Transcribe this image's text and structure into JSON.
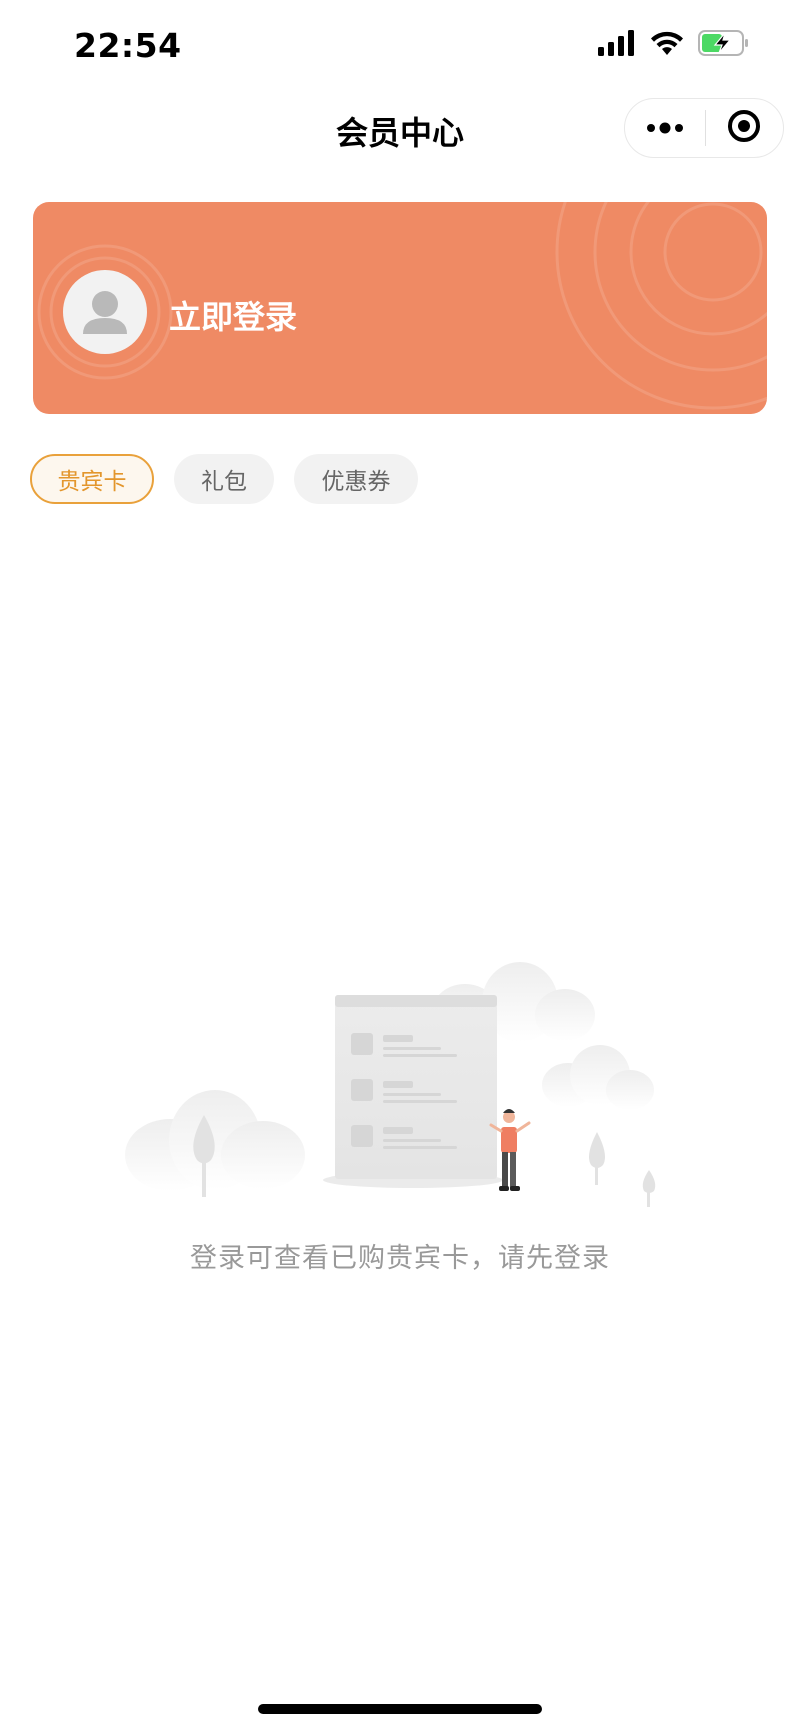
{
  "status_bar": {
    "time": "22:54",
    "icons": [
      "signal-icon",
      "wifi-icon",
      "battery-charging-icon"
    ]
  },
  "nav": {
    "title": "会员中心",
    "more_icon": "more-dots-icon",
    "close_icon": "target-close-icon"
  },
  "banner": {
    "login_label": "立即登录",
    "avatar_icon": "user-avatar-icon",
    "color": "#ef8a64"
  },
  "tabs": [
    {
      "label": "贵宾卡",
      "active": true
    },
    {
      "label": "礼包",
      "active": false
    },
    {
      "label": "优惠券",
      "active": false
    }
  ],
  "empty_state": {
    "illustration": "empty-list-illustration",
    "message": "登录可查看已购贵宾卡，请先登录"
  },
  "colors": {
    "accent": "#e9a13b",
    "banner": "#ef8a64",
    "muted_text": "#999999"
  }
}
